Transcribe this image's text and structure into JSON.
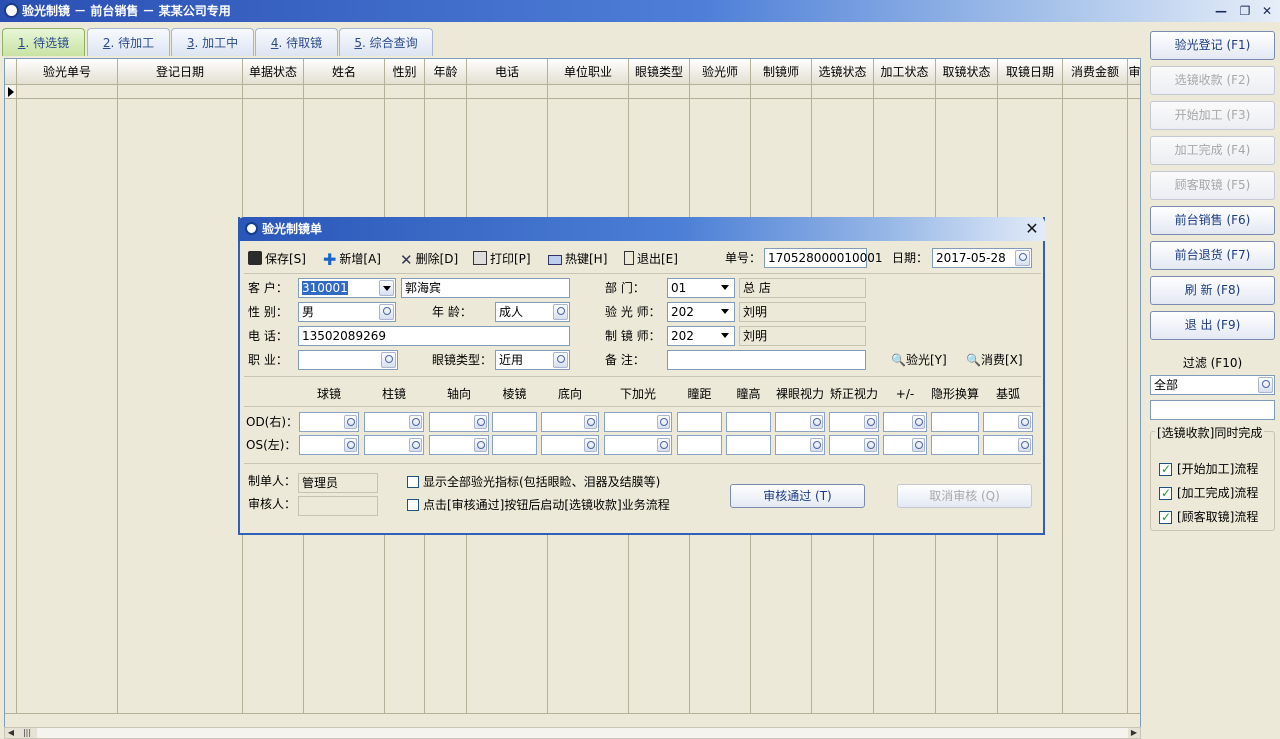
{
  "window": {
    "title": "验光制镜 － 前台销售 － 某某公司专用"
  },
  "tabs": [
    {
      "num": "1",
      "label": ". 待选镜"
    },
    {
      "num": "2",
      "label": ". 待加工"
    },
    {
      "num": "3",
      "label": ". 加工中"
    },
    {
      "num": "4",
      "label": ". 待取镜"
    },
    {
      "num": "5",
      "label": ". 综合查询"
    }
  ],
  "grid": {
    "columns": [
      "验光单号",
      "登记日期",
      "单据状态",
      "姓名",
      "性别",
      "年龄",
      "电话",
      "单位职业",
      "眼镜类型",
      "验光师",
      "制镜师",
      "选镜状态",
      "加工状态",
      "取镜状态",
      "取镜日期",
      "消费金额",
      "审"
    ]
  },
  "right_panel": {
    "buttons": [
      {
        "label": "验光登记 (F1)",
        "enabled": true
      },
      {
        "label": "选镜收款 (F2)",
        "enabled": false
      },
      {
        "label": "开始加工 (F3)",
        "enabled": false
      },
      {
        "label": "加工完成 (F4)",
        "enabled": false
      },
      {
        "label": "顾客取镜 (F5)",
        "enabled": false
      },
      {
        "label": "前台销售 (F6)",
        "enabled": true
      },
      {
        "label": "前台退货 (F7)",
        "enabled": true
      },
      {
        "label": "刷  新 (F8)",
        "enabled": true
      },
      {
        "label": "退  出 (F9)",
        "enabled": true
      }
    ],
    "filter_label": "过滤 (F10)",
    "filter_value": "全部",
    "filter_text": "",
    "group_title": "[选镜收款]同时完成",
    "checks": [
      {
        "label": "[开始加工]流程",
        "checked": true
      },
      {
        "label": "[加工完成]流程",
        "checked": true
      },
      {
        "label": "[顾客取镜]流程",
        "checked": true
      }
    ]
  },
  "dialog": {
    "title": "验光制镜单",
    "toolbar": {
      "save": "保存[S]",
      "add": "新增[A]",
      "delete": "删除[D]",
      "print": "打印[P]",
      "hotkey": "热键[H]",
      "exit": "退出[E]"
    },
    "order_no_label": "单号：",
    "order_no": "170528000010001",
    "date_label": "日期：",
    "date": "2017-05-28",
    "customer_label": "客  户：",
    "customer_code": "310001",
    "customer_name": "郭海宾",
    "gender_label": "性  别：",
    "gender": "男",
    "age_label": "年    龄：",
    "age": "成人",
    "phone_label": "电  话：",
    "phone": "13502089269",
    "job_label": "职  业：",
    "job": "",
    "glasses_type_label": "眼镜类型：",
    "glasses_type": "近用",
    "dept_label": "部    门：",
    "dept_code": "01",
    "dept_name": "总  店",
    "optometrist_label": "验 光 师：",
    "optometrist_code": "202",
    "optometrist_name": "刘明",
    "maker_label": "制 镜 师：",
    "maker_code": "202",
    "maker_name": "刘明",
    "note_label": "备    注：",
    "note": "",
    "optometry_btn": "验光[Y]",
    "consume_btn": "消费[X]",
    "rx_columns": [
      "球镜",
      "柱镜",
      "轴向",
      "棱镜",
      "底向",
      "下加光",
      "瞳距",
      "瞳高",
      "裸眼视力",
      "矫正视力",
      "+/-",
      "隐形换算",
      "基弧"
    ],
    "od_label": "OD(右)：",
    "os_label": "OS(左)：",
    "creator_label": "制单人：",
    "creator": "管理员",
    "reviewer_label": "审核人：",
    "reviewer": "",
    "show_all_label": "显示全部验光指标(包括眼睑、泪器及结膜等)",
    "auto_start_label": "点击[审核通过]按钮后启动[选镜收款]业务流程",
    "approve_btn": "审核通过 (T)",
    "cancel_review_btn": "取消审核 (Q)"
  }
}
